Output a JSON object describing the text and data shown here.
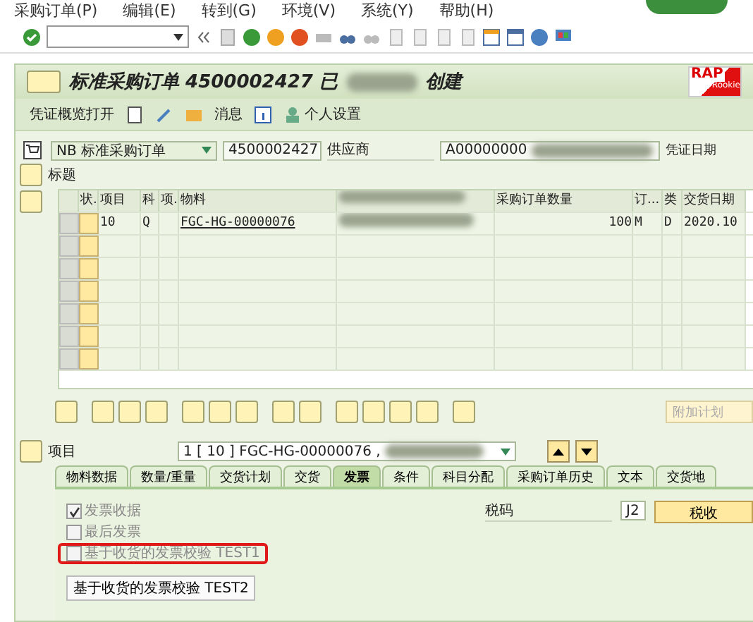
{
  "menu": [
    {
      "label": "采购订单(P)"
    },
    {
      "label": "编辑(E)"
    },
    {
      "label": "转到(G)"
    },
    {
      "label": "环境(V)"
    },
    {
      "label": "系统(Y)"
    },
    {
      "label": "帮助(H)"
    }
  ],
  "title": {
    "before": "标准采购订单 4500002427 已",
    "after": "创建"
  },
  "logo": {
    "main": "RAP",
    "sub": "Rookie"
  },
  "app_toolbar": {
    "overview": "凭证概览打开",
    "messages": "消息",
    "settings": "个人设置"
  },
  "header": {
    "doc_type": "NB 标准采购订单",
    "po_number": "4500002427",
    "vendor_label": "供应商",
    "vendor": "A00000000",
    "date_label": "凭证日期"
  },
  "section_title": "标题",
  "table": {
    "columns": [
      "状.",
      "项目",
      "科",
      "项.",
      "物料",
      "",
      "采购订单数量",
      "订...",
      "类",
      "交货日期"
    ],
    "rows": [
      [
        "",
        "10",
        "Q",
        "",
        "FGC-HG-00000076",
        "",
        "100",
        "M",
        "D",
        "2020.10"
      ]
    ]
  },
  "extra_button": "附加计划",
  "item": {
    "label": "项目",
    "value": "1 [ 10 ] FGC-HG-00000076 ,"
  },
  "tabs": [
    {
      "label": "物料数据",
      "selected": false
    },
    {
      "label": "数量/重量",
      "selected": false
    },
    {
      "label": "交货计划",
      "selected": false
    },
    {
      "label": "交货",
      "selected": false
    },
    {
      "label": "发票",
      "selected": true
    },
    {
      "label": "条件",
      "selected": false
    },
    {
      "label": "科目分配",
      "selected": false
    },
    {
      "label": "采购订单历史",
      "selected": false
    },
    {
      "label": "文本",
      "selected": false
    },
    {
      "label": "交货地",
      "selected": false
    }
  ],
  "checks": [
    {
      "label": "发票收据",
      "checked": true,
      "highlighted": false
    },
    {
      "label": "最后发票",
      "checked": false,
      "highlighted": false
    },
    {
      "label": "基于收货的发票校验 TEST1",
      "checked": false,
      "highlighted": true
    }
  ],
  "test_button": "基于收货的发票校验 TEST2",
  "tax": {
    "label": "税码",
    "code": "J2",
    "button": "税收"
  }
}
